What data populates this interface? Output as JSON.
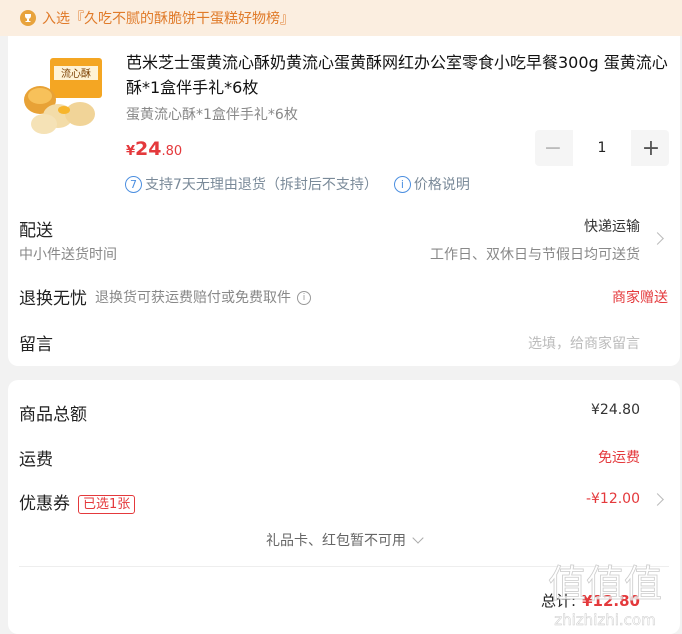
{
  "banner": {
    "text": "入选『久吃不腻的酥脆饼干蛋糕好物榜』"
  },
  "product": {
    "title": "芭米芝士蛋黄流心酥奶黄流心蛋黄酥网红办公室零食小吃早餐300g 蛋黄流心酥*1盒伴手礼*6枚",
    "spec": "蛋黄流心酥*1盒伴手礼*6枚",
    "price_currency": "¥",
    "price_int": "24",
    "price_dec": ".80",
    "box_text": "流心酥",
    "quantity": "1",
    "minus": "−",
    "plus": "+",
    "service_badge": "7",
    "service_text": "支持7天无理由退货（拆封后不支持）",
    "price_note_icon": "i",
    "price_note": "价格说明"
  },
  "delivery": {
    "label": "配送",
    "sub": "中小件送货时间",
    "method": "快递运输",
    "time": "工作日、双休日与节假日均可送货"
  },
  "returns": {
    "label": "退换无忧",
    "desc": "退换货可获运费赔付或免费取件",
    "info_icon": "i",
    "right": "商家赠送"
  },
  "message": {
    "label": "留言",
    "placeholder": "选填，给商家留言"
  },
  "summary": {
    "goods_label": "商品总额",
    "goods_value": "¥24.80",
    "freight_label": "运费",
    "freight_value": "免运费",
    "coupon_label": "优惠券",
    "coupon_badge": "已选1张",
    "coupon_value": "-¥12.00",
    "gift_text": "礼品卡、红包暂不可用",
    "total_label": "总计:",
    "total_value": "¥12.80"
  },
  "watermark": {
    "text": "值值值",
    "url": "zhizhizhi.com"
  },
  "colors": {
    "accent_red": "#e4393c",
    "banner_bg": "#fbeee0",
    "banner_text": "#e07b2a",
    "link_blue": "#4c8fe0"
  }
}
